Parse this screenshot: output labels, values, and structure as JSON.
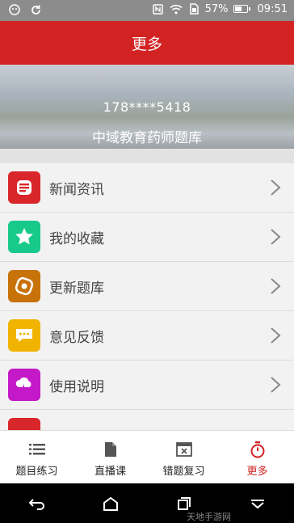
{
  "status_bar": {
    "battery": "57%",
    "battery_level": 0.57,
    "time": "09:51",
    "icons": [
      "alien-icon",
      "sync-icon",
      "nfc-icon",
      "wifi-icon",
      "sim-icon",
      "battery-icon"
    ]
  },
  "header": {
    "title": "更多"
  },
  "banner": {
    "phone": "178****5418",
    "name": "中域教育药师题库"
  },
  "menu": [
    {
      "label": "新闻资讯",
      "icon": "news-icon",
      "color": "#d9262a"
    },
    {
      "label": "我的收藏",
      "icon": "star-icon",
      "color": "#17c98a"
    },
    {
      "label": "更新题库",
      "icon": "refresh-icon",
      "color": "#c8720a"
    },
    {
      "label": "意见反馈",
      "icon": "chat-icon",
      "color": "#f0b400"
    },
    {
      "label": "使用说明",
      "icon": "cloud-icon",
      "color": "#c319c8"
    },
    {
      "label": "",
      "icon": "partial-icon",
      "color": "#d9262a"
    }
  ],
  "tabs": [
    {
      "label": "题目练习",
      "icon": "list-icon"
    },
    {
      "label": "直播课",
      "icon": "document-icon"
    },
    {
      "label": "错题复习",
      "icon": "window-x-icon"
    },
    {
      "label": "更多",
      "icon": "stopwatch-icon",
      "active": true
    }
  ],
  "accent_color": "#d32222",
  "watermark": "天地手游网"
}
